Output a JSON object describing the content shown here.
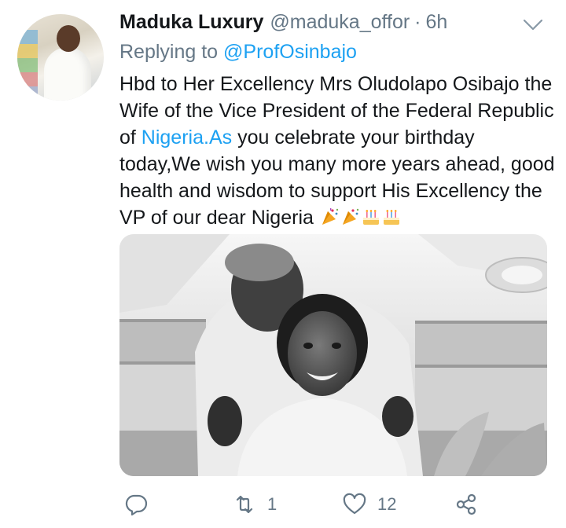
{
  "tweet": {
    "author": {
      "display_name": "Maduka Luxury",
      "handle": "@maduka_offor"
    },
    "separator": "·",
    "timestamp": "6h",
    "replying_prefix": "Replying to ",
    "replying_to": "@ProfOsinbajo",
    "text_part1": "Hbd to Her Excellency Mrs Oludolapo Osibajo the Wife of the Vice President of the Federal Republic of ",
    "text_link": "Nigeria.As",
    "text_part2": " you celebrate your birthday today,We wish you many more years ahead, good health and wisdom to support His Excellency the VP of our dear Nigeria ",
    "emojis": [
      "party-popper-icon",
      "party-popper-icon",
      "birthday-cake-icon",
      "birthday-cake-icon"
    ],
    "image": {
      "subject": "black-and-white-photo"
    },
    "actions": {
      "reply_icon": "reply-icon",
      "retweet_icon": "retweet-icon",
      "retweet_count": "1",
      "like_icon": "heart-icon",
      "like_count": "12",
      "share_icon": "share-icon"
    }
  },
  "colors": {
    "text": "#14171a",
    "secondary": "#657786",
    "link": "#1da1f2",
    "background": "#ffffff"
  }
}
